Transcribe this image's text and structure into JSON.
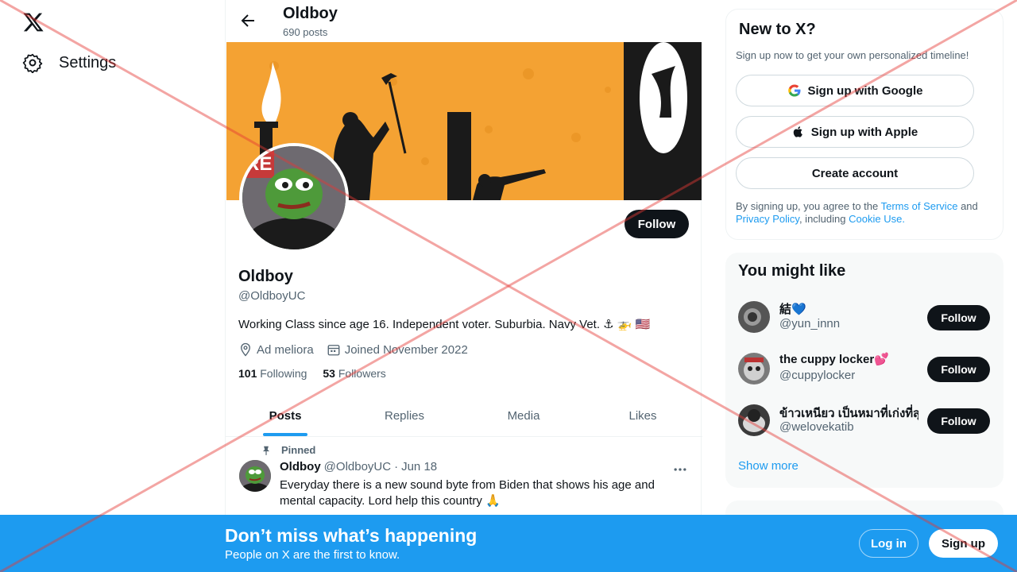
{
  "nav": {
    "settings_label": "Settings"
  },
  "header": {
    "title": "Oldboy",
    "post_count": "690 posts"
  },
  "profile": {
    "follow_label": "Follow",
    "name": "Oldboy",
    "handle": "@OldboyUC",
    "bio": "Working Class since age 16. Independent voter. Suburbia. Navy Vet. ⚓ 🚁 🇺🇸",
    "location": "Ad meliora",
    "joined": "Joined November 2022",
    "following_count": "101",
    "following_label": "Following",
    "followers_count": "53",
    "followers_label": "Followers"
  },
  "tabs": [
    {
      "label": "Posts"
    },
    {
      "label": "Replies"
    },
    {
      "label": "Media"
    },
    {
      "label": "Likes"
    }
  ],
  "post": {
    "pinned_label": "Pinned",
    "author": "Oldboy",
    "handle": "@OldboyUC",
    "separator": "·",
    "date": "Jun 18",
    "text": "Everyday there is a new sound byte from Biden that shows his age and mental capacity. Lord help this country 🙏"
  },
  "signup_card": {
    "title": "New to X?",
    "subtitle": "Sign up now to get your own personalized timeline!",
    "google_label": "Sign up with Google",
    "apple_label": "Sign up with Apple",
    "create_label": "Create account",
    "legal_prefix": "By signing up, you agree to the",
    "terms": "Terms of Service",
    "and": "and",
    "privacy": "Privacy Policy",
    "including": ", including",
    "cookie": "Cookie Use."
  },
  "suggestions": {
    "title": "You might like",
    "items": [
      {
        "name": "結💙",
        "handle": "@yun_innn",
        "follow": "Follow"
      },
      {
        "name": "the cuppy locker💕",
        "handle": "@cuppylocker",
        "follow": "Follow"
      },
      {
        "name": "ข้าวเหนียว เป็นหมาที่เก่งที่สุด",
        "handle": "@welovekatib",
        "follow": "Follow"
      }
    ],
    "show_more": "Show more"
  },
  "bottom": {
    "title": "Don’t miss what’s happening",
    "subtitle": "People on X are the first to know.",
    "login": "Log in",
    "signup": "Sign up"
  },
  "colors": {
    "accent": "#1d9bf0",
    "dark": "#0f1419",
    "muted": "#536471",
    "banner": "#f4a233"
  }
}
